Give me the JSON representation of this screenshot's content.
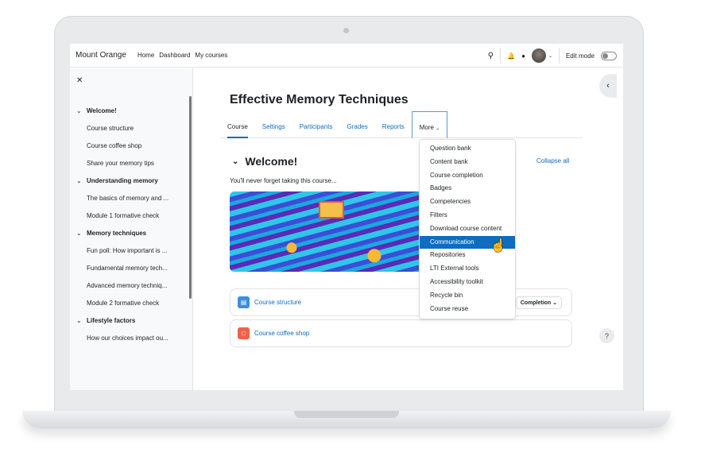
{
  "nav": {
    "brand": "Mount Orange",
    "links": [
      "Home",
      "Dashboard",
      "My courses"
    ],
    "edit_mode_label": "Edit mode",
    "edit_mode_on": false
  },
  "sidebar": {
    "sections": [
      {
        "title": "Welcome!",
        "items": [
          "Course structure",
          "Course coffee shop",
          "Share your memory tips"
        ]
      },
      {
        "title": "Understanding memory",
        "items": [
          "The basics of memory and ...",
          "Module 1 formative check"
        ]
      },
      {
        "title": "Memory techniques",
        "items": [
          "Fun poll: How important is ...",
          "Fundamental memory tech...",
          "Advanced memory techniq...",
          "Module 2 formative check"
        ]
      },
      {
        "title": "Lifestyle factors",
        "items": [
          "How our choices impact ou..."
        ]
      }
    ]
  },
  "course": {
    "title": "Effective Memory Techniques",
    "tabs": [
      "Course",
      "Settings",
      "Participants",
      "Grades",
      "Reports",
      "More"
    ],
    "section_title": "Welcome!",
    "collapse_all": "Collapse all",
    "summary": "You'll never forget taking this course...",
    "activities": [
      {
        "name": "Course structure",
        "icon": "page-icon",
        "color": "#3b8de0",
        "completion": "Completion"
      },
      {
        "name": "Course coffee shop",
        "icon": "forum-icon",
        "color": "#f06148"
      }
    ]
  },
  "more_menu": {
    "items": [
      "Question bank",
      "Content bank",
      "Course completion",
      "Badges",
      "Competencies",
      "Filters",
      "Download course content",
      "Communication",
      "Repositories",
      "LTI External tools",
      "Accessibility toolkit",
      "Recycle bin",
      "Course reuse"
    ],
    "highlighted": "Communication",
    "accent": "#0f6cbf"
  },
  "help": "?"
}
